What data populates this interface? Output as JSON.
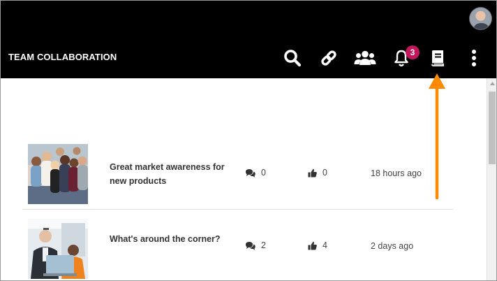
{
  "header": {
    "app_title": "TEAM COLLABORATION",
    "notification_count": "3",
    "icons": [
      "search-icon",
      "link-icon",
      "people-icon",
      "bell-icon",
      "book-icon",
      "more-vertical-icon"
    ],
    "badge_color": "#c2185b",
    "annotation_arrow_color": "#ff8a00"
  },
  "posts": [
    {
      "title": "Great market awareness for new products",
      "comments": "0",
      "likes": "0",
      "time": "18 hours ago"
    },
    {
      "title": "What's around the corner?",
      "comments": "2",
      "likes": "4",
      "time": "2 days ago"
    }
  ]
}
